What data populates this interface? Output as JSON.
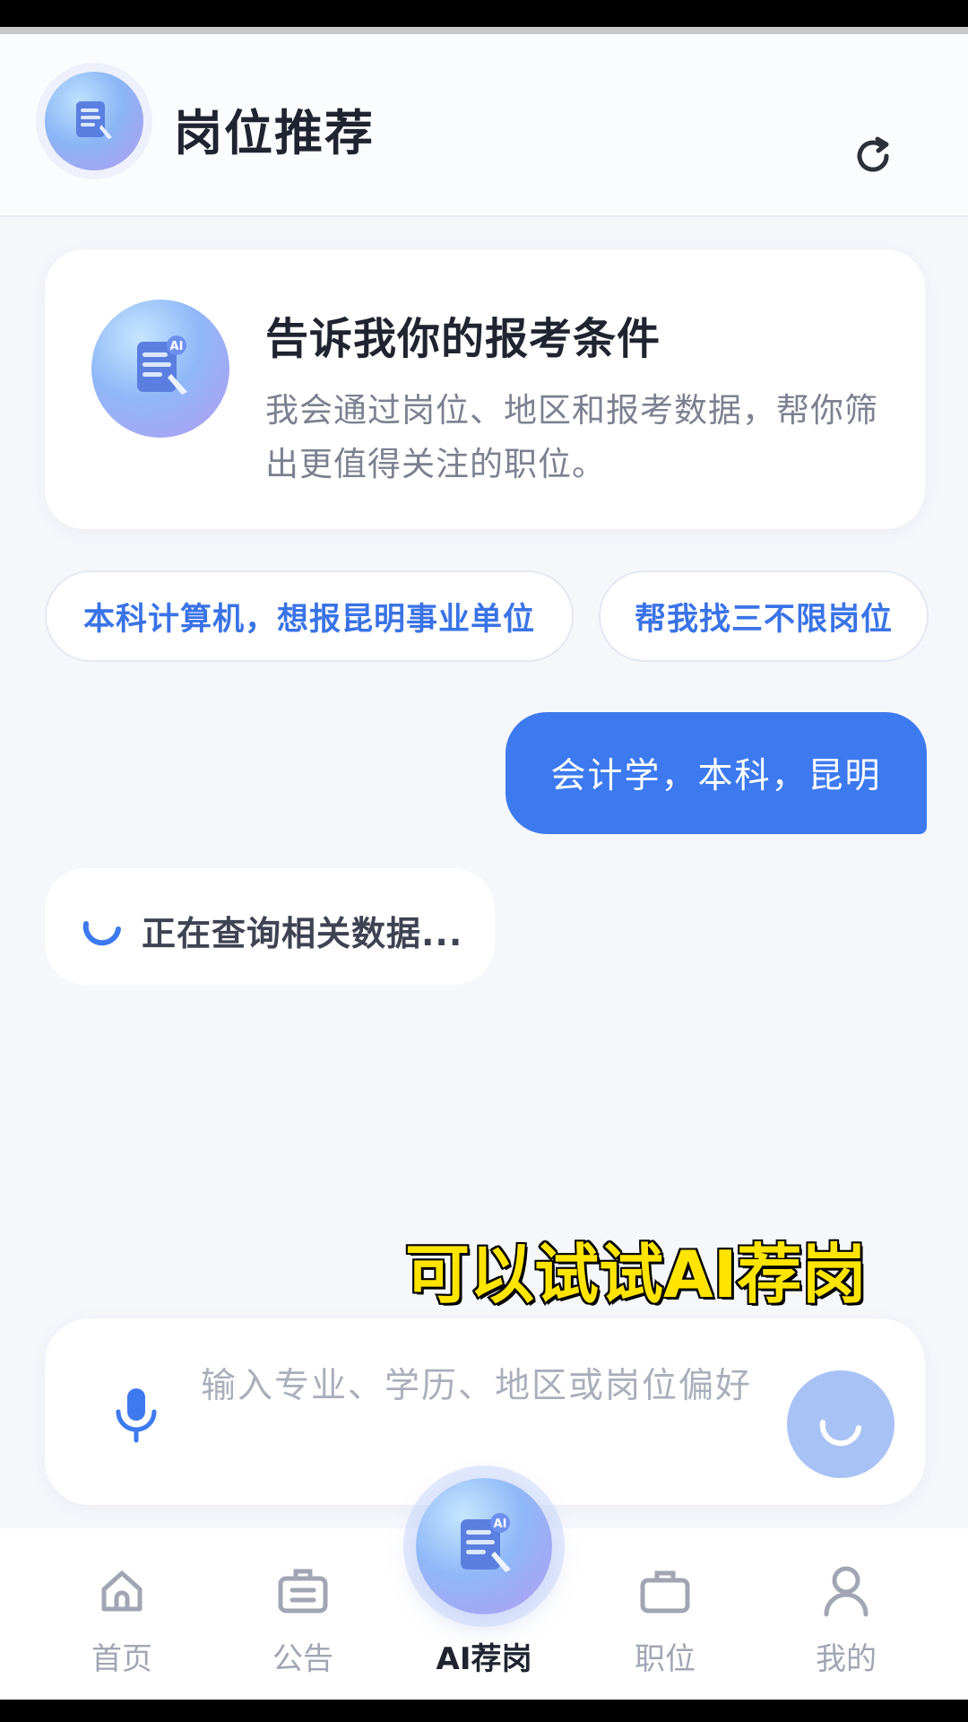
{
  "header": {
    "title": "岗位推荐",
    "avatar_icon": "ai-document-icon",
    "refresh_icon": "refresh-icon"
  },
  "intro": {
    "title": "告诉我你的报考条件",
    "description": "我会通过岗位、地区和报考数据，帮你筛出更值得关注的职位。"
  },
  "suggestions": [
    {
      "label": "本科计算机，想报昆明事业单位"
    },
    {
      "label": "帮我找三不限岗位"
    }
  ],
  "chat": {
    "user_message": "会计学，本科，昆明",
    "loading_text": "正在查询相关数据..."
  },
  "caption": "可以试试AI荐岗",
  "input": {
    "placeholder": "输入专业、学历、地区或岗位偏好"
  },
  "nav": {
    "items": [
      {
        "label": "首页",
        "icon": "home-icon"
      },
      {
        "label": "公告",
        "icon": "notice-icon"
      },
      {
        "label": "AI荐岗",
        "icon": "ai-document-icon"
      },
      {
        "label": "职位",
        "icon": "briefcase-icon"
      },
      {
        "label": "我的",
        "icon": "user-icon"
      }
    ]
  },
  "colors": {
    "accent": "#3d7af0",
    "chip_text": "#3a73e6",
    "caption": "#ffe400"
  }
}
